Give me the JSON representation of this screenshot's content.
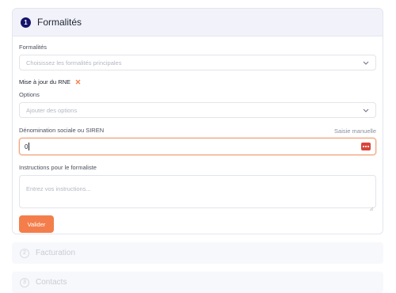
{
  "sections": {
    "main": {
      "step": "1",
      "title": "Formalités",
      "formalites": {
        "label": "Formalités",
        "placeholder": "Choisissez les formalités principales",
        "selected_tag": "Mise à jour du RNE"
      },
      "options": {
        "label": "Options",
        "placeholder": "Ajouter des options"
      },
      "denomination": {
        "label": "Dénomination sociale ou SIREN",
        "link": "Saisie manuelle",
        "value": "0"
      },
      "instructions": {
        "label": "Instructions pour le formaliste",
        "placeholder": "Entrez vos instructions..."
      },
      "submit_label": "Valider"
    },
    "billing": {
      "step": "2",
      "title": "Facturation"
    },
    "contacts": {
      "step": "3",
      "title": "Contacts"
    }
  },
  "colors": {
    "accent": "#f47e4b",
    "step_active": "#14146b",
    "more_button": "#d9453b"
  },
  "icons": {
    "chevron": "chevron-down-icon",
    "remove": "close-icon",
    "more": "more-horizontal-icon"
  }
}
